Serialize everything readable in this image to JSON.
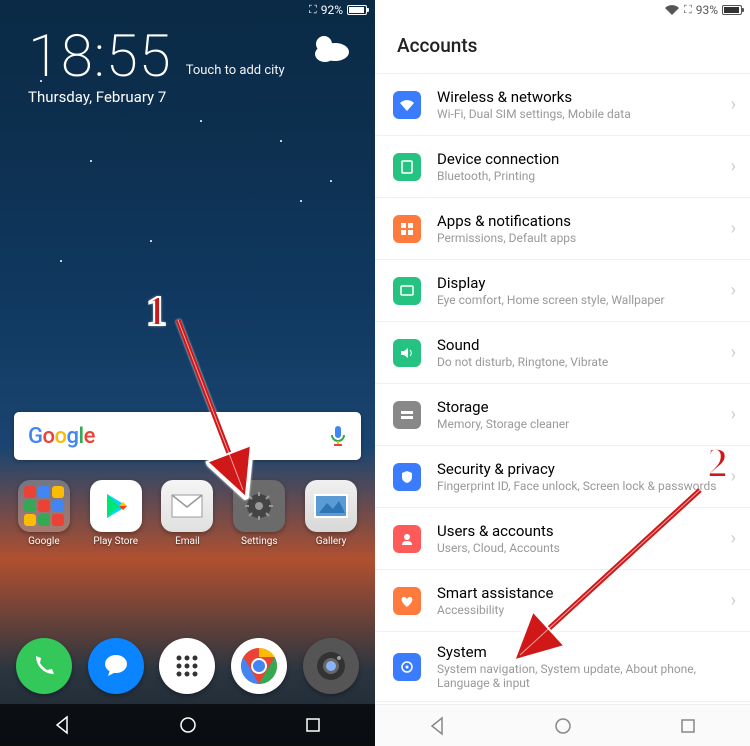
{
  "left": {
    "status": {
      "battery": "92%"
    },
    "clock": "18:55",
    "touch_city": "Touch to add city",
    "date": "Thursday, February 7",
    "search_brand": "Google",
    "apps": [
      {
        "label": "Google"
      },
      {
        "label": "Play Store"
      },
      {
        "label": "Email"
      },
      {
        "label": "Settings"
      },
      {
        "label": "Gallery"
      }
    ]
  },
  "right": {
    "status": {
      "battery": "93%"
    },
    "title": "Accounts",
    "rows": [
      {
        "title": "Wireless & networks",
        "sub": "Wi-Fi, Dual SIM settings, Mobile data",
        "color": "#3b7cff"
      },
      {
        "title": "Device connection",
        "sub": "Bluetooth, Printing",
        "color": "#26c281"
      },
      {
        "title": "Apps & notifications",
        "sub": "Permissions, Default apps",
        "color": "#ff7a3d"
      },
      {
        "title": "Display",
        "sub": "Eye comfort, Home screen style, Wallpaper",
        "color": "#26c281"
      },
      {
        "title": "Sound",
        "sub": "Do not disturb, Ringtone, Vibrate",
        "color": "#26c281"
      },
      {
        "title": "Storage",
        "sub": "Memory, Storage cleaner",
        "color": "#888"
      },
      {
        "title": "Security & privacy",
        "sub": "Fingerprint ID, Face unlock, Screen lock & passwords",
        "color": "#3b7cff"
      },
      {
        "title": "Users & accounts",
        "sub": "Users, Cloud, Accounts",
        "color": "#ff5a5a"
      },
      {
        "title": "Smart assistance",
        "sub": "Accessibility",
        "color": "#ff7a3d"
      },
      {
        "title": "System",
        "sub": "System navigation, System update, About phone, Language & input",
        "color": "#3b7cff"
      }
    ]
  },
  "annotations": {
    "step1": "1",
    "step2": "2"
  }
}
